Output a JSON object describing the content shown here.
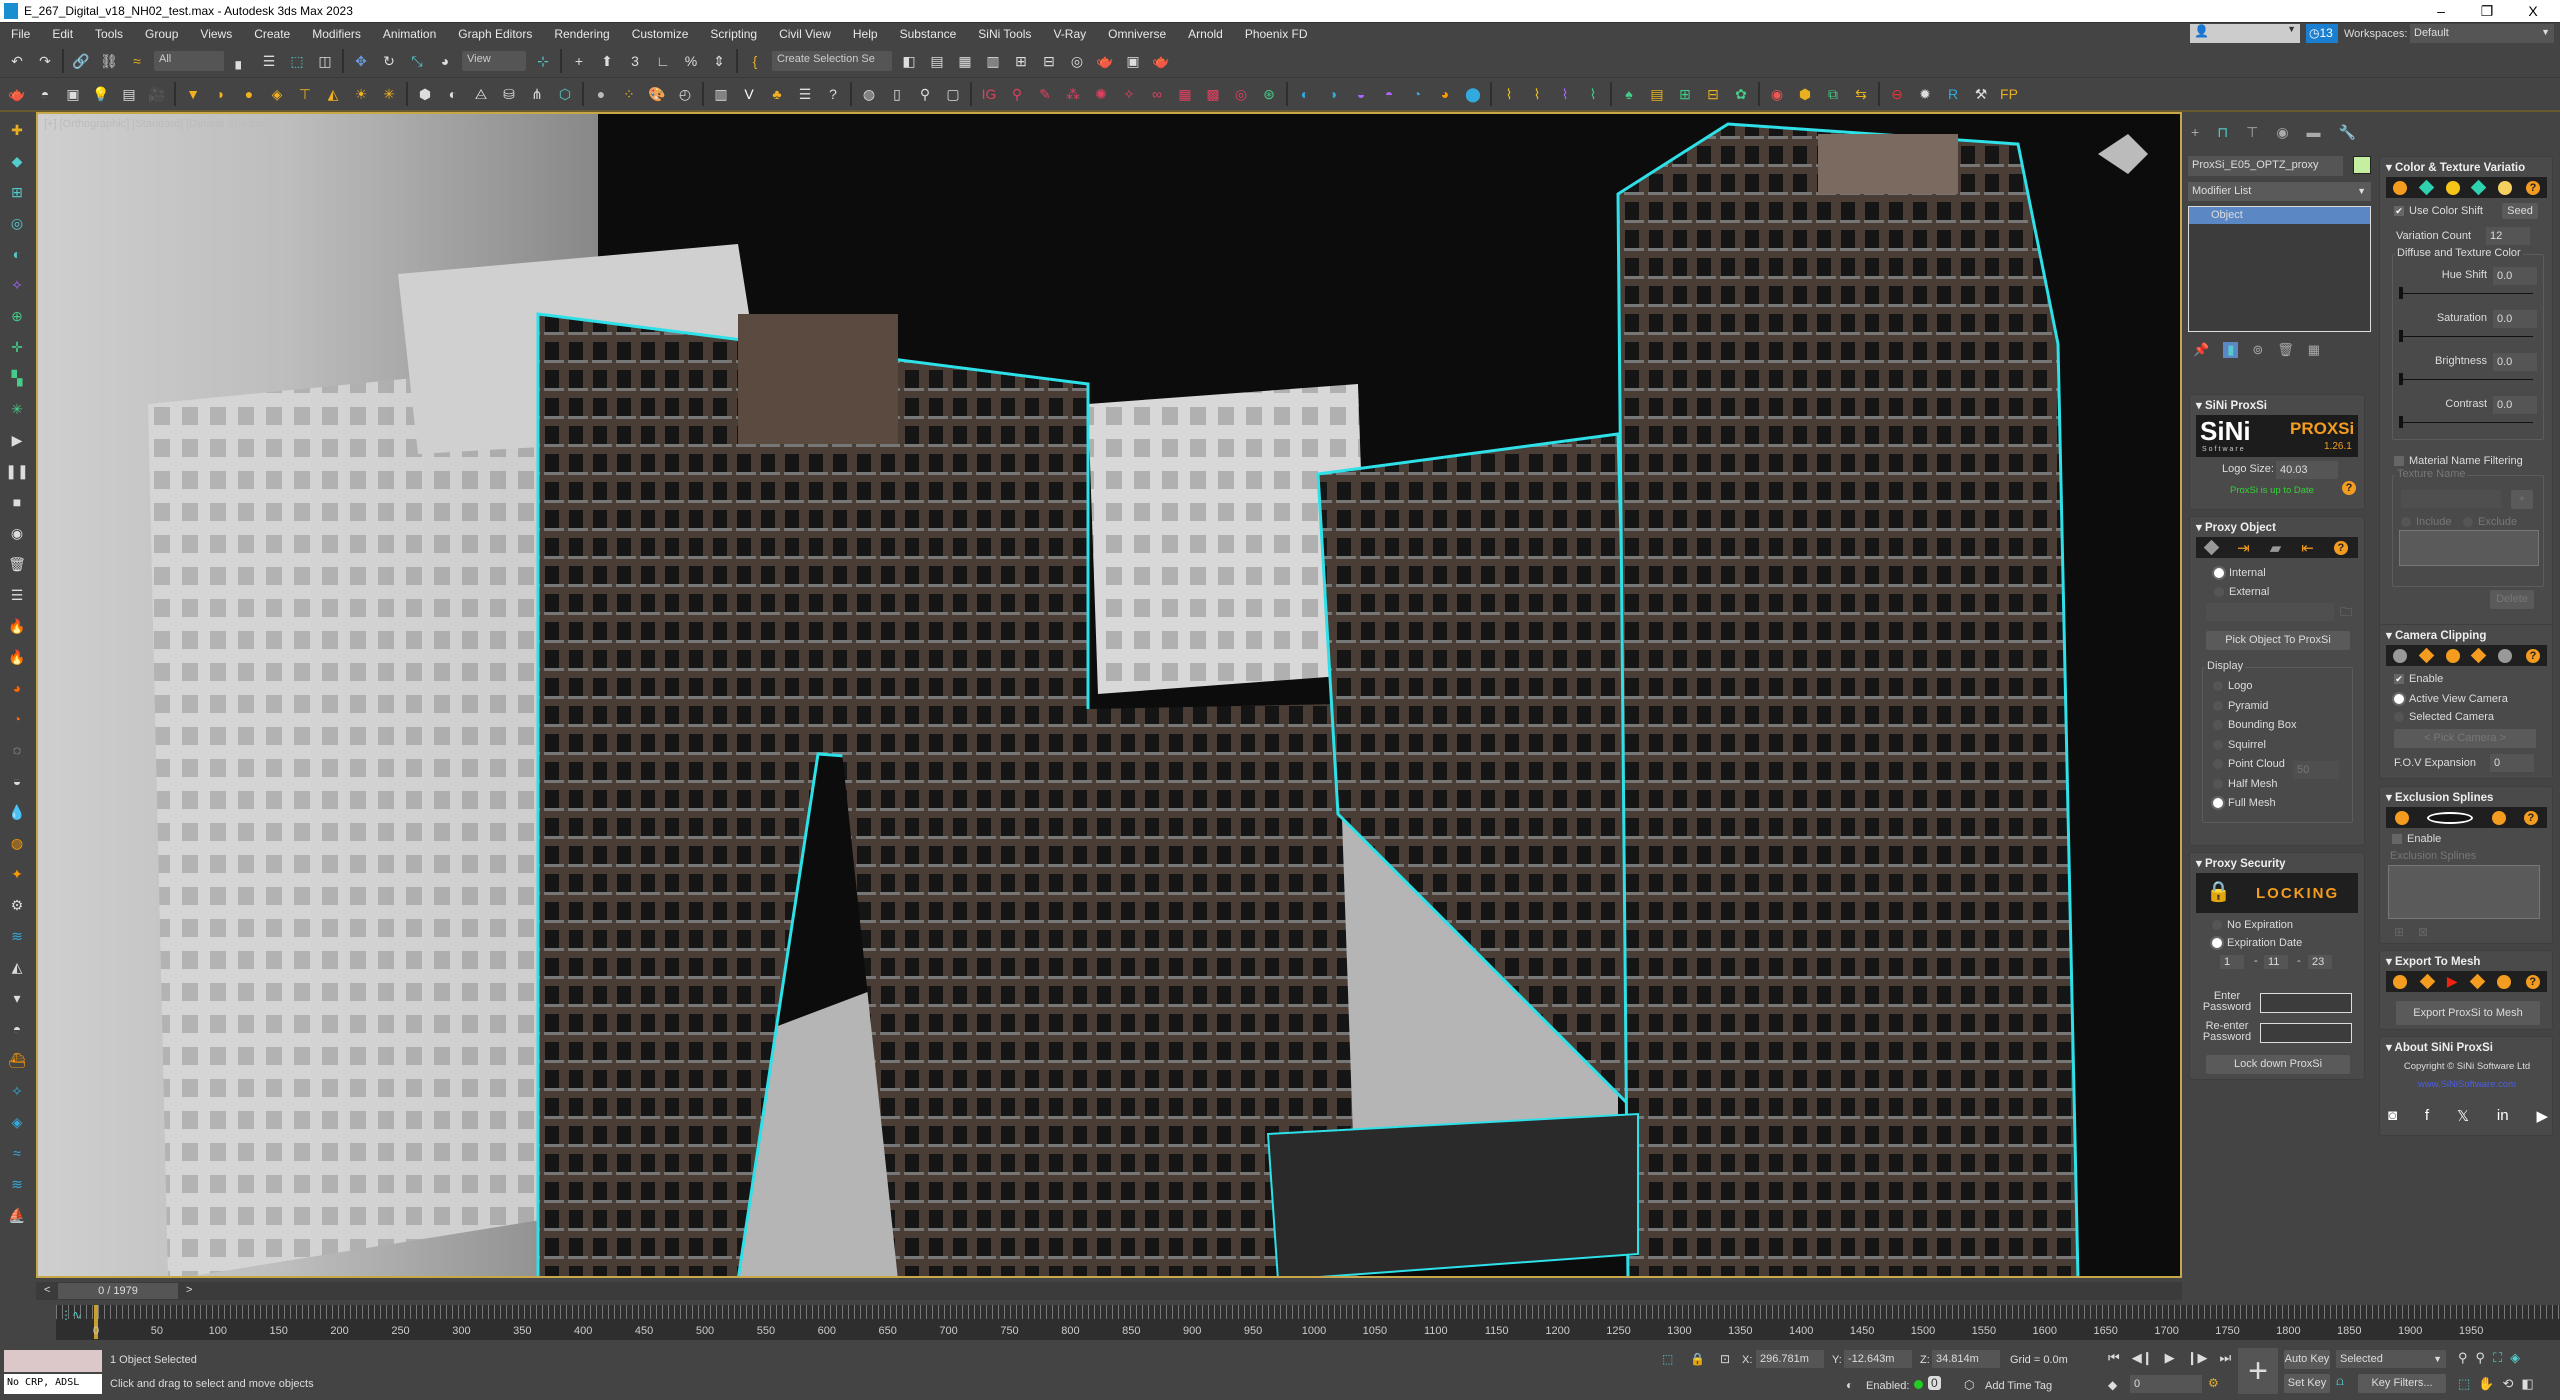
{
  "window": {
    "title": "E_267_Digital_v18_NH02_test.max - Autodesk 3ds Max 2023",
    "minimize": "–",
    "restore": "❐",
    "close": "X"
  },
  "menu": [
    "File",
    "Edit",
    "Tools",
    "Group",
    "Views",
    "Create",
    "Modifiers",
    "Animation",
    "Graph Editors",
    "Rendering",
    "Customize",
    "Scripting",
    "Civil View",
    "Help",
    "Substance",
    "SiNi Tools",
    "V-Ray",
    "Omniverse",
    "Arnold",
    "Phoenix FD"
  ],
  "account": {
    "user_dropdown": "",
    "notifications": "13",
    "workspaces_label": "Workspaces:",
    "workspace": "Default"
  },
  "toolbar1": {
    "selection_filter": "All",
    "ref_coord": "View",
    "named_selection": "Create Selection Se",
    "icons": [
      [
        "undo-icon",
        "#ddd",
        "↶"
      ],
      [
        "redo-icon",
        "#ddd",
        "↷"
      ],
      [
        "sep"
      ],
      [
        "link-icon",
        "#ddd",
        "🔗"
      ],
      [
        "unlink-icon",
        "#ddd",
        "⛓"
      ],
      [
        "bind-space-warp-icon",
        "#e8b020",
        "≈"
      ],
      [
        "DD1"
      ],
      [
        "select-object-icon",
        "#ddd",
        "▖"
      ],
      [
        "select-by-name-icon",
        "#ddd",
        "☰"
      ],
      [
        "rect-selection-icon",
        "#5cc",
        "⬚"
      ],
      [
        "window-crossing-icon",
        "#ddd",
        "◫"
      ],
      [
        "sep"
      ],
      [
        "select-move-icon",
        "#6a9ad8",
        "✥"
      ],
      [
        "select-rotate-icon",
        "#ddd",
        "↻"
      ],
      [
        "select-scale-icon",
        "#5cc",
        "⤡"
      ],
      [
        "place-icon",
        "#ddd",
        "◕"
      ],
      [
        "DD2"
      ],
      [
        "pivot-icon",
        "#5cc",
        "⊹"
      ],
      [
        "sep"
      ],
      [
        "keyboard-shortcut-icon",
        "#ddd",
        "+"
      ],
      [
        "snaps-toggle-icon",
        "#ddd",
        "⬆"
      ],
      [
        "angle-snap-icon",
        "#ddd",
        "3"
      ],
      [
        "percent-snap-icon",
        "#ddd",
        "∟"
      ],
      [
        "spinner-snap-icon",
        "#ddd",
        "%"
      ],
      [
        "edit-named-sel-icon",
        "#ddd",
        "⇕"
      ],
      [
        "sep"
      ],
      [
        "braces-icon",
        "#e8b020",
        "{"
      ],
      [
        "DD3"
      ],
      [
        "mirror-icon",
        "#ddd",
        "◧"
      ],
      [
        "align-icon",
        "#ddd",
        "▤"
      ],
      [
        "layer-explorer-icon",
        "#ddd",
        "▦"
      ],
      [
        "toggle-ribbon-icon",
        "#ddd",
        "▥"
      ],
      [
        "curve-editor-icon",
        "#ddd",
        "⊞"
      ],
      [
        "schematic-icon",
        "#ddd",
        "⊟"
      ],
      [
        "material-editor-icon",
        "#ddd",
        "◎"
      ],
      [
        "render-setup-icon",
        "#ddd",
        "🫖"
      ],
      [
        "rendered-frame-icon",
        "#ddd",
        "▣"
      ],
      [
        "render-icon",
        "#ddd",
        "🫖"
      ]
    ]
  },
  "toolbar2": {
    "icons": [
      [
        "teapot-icon",
        "#ddd",
        "🫖"
      ],
      [
        "sphere-gizmo-icon",
        "#ddd",
        "◓"
      ],
      [
        "container-icon",
        "#ddd",
        "▣"
      ],
      [
        "light-lister-icon",
        "#e8b020",
        "💡"
      ],
      [
        "camera-list-icon",
        "#ddd",
        "▤"
      ],
      [
        "camera-icon",
        "#ddd",
        "🎥"
      ],
      [
        "sep"
      ],
      [
        "spot-light-icon",
        "#f0b020",
        "▼"
      ],
      [
        "dome-light-icon",
        "#f0b020",
        "◗"
      ],
      [
        "sphere-light-icon",
        "#f0b020",
        "●"
      ],
      [
        "mesh-light-icon",
        "#f0b020",
        "◈"
      ],
      [
        "ies-light-icon",
        "#f0b020",
        "⊤"
      ],
      [
        "ambient-light-icon",
        "#f0b020",
        "◭"
      ],
      [
        "sun-icon",
        "#f0b020",
        "☀"
      ],
      [
        "sky-icon",
        "#f0b020",
        "✳"
      ],
      [
        "sep"
      ],
      [
        "proxy-icon",
        "#ddd",
        "⬢"
      ],
      [
        "fur-icon",
        "#ddd",
        "◐"
      ],
      [
        "plane-icon",
        "#ddd",
        "⨺"
      ],
      [
        "instancer-icon",
        "#ddd",
        "⛁"
      ],
      [
        "grass-icon",
        "#ddd",
        "⋔"
      ],
      [
        "volume-icon",
        "#5cc",
        "⬡"
      ],
      [
        "sep"
      ],
      [
        "material-ball-icon",
        "#bbb",
        "●"
      ],
      [
        "multi-material-icon",
        "#f0b020",
        "⁘"
      ],
      [
        "palette-icon",
        "#ddd",
        "🎨"
      ],
      [
        "tex-icon",
        "#ddd",
        "◴"
      ],
      [
        "sep"
      ],
      [
        "lister-icon",
        "#ddd",
        "▥"
      ],
      [
        "vray-logo-icon",
        "#fff",
        "V"
      ],
      [
        "tree-icon",
        "#f0b020",
        "♣"
      ],
      [
        "notes-icon",
        "#ddd",
        "☰"
      ],
      [
        "help-icon",
        "#ddd",
        "?"
      ],
      [
        "sep"
      ],
      [
        "globe-icon",
        "#ddd",
        "◍"
      ],
      [
        "file-icon",
        "#ddd",
        "▯"
      ],
      [
        "pin-icon",
        "#ddd",
        "⚲"
      ],
      [
        "box-icon",
        "#ddd",
        "▢"
      ],
      [
        "sep"
      ],
      [
        "ig-icon",
        "#e04060",
        "IG"
      ],
      [
        "magnify-icon",
        "#e04060",
        "⚲"
      ],
      [
        "brush-icon",
        "#e04060",
        "✎"
      ],
      [
        "scatter-icon",
        "#e04060",
        "⁂"
      ],
      [
        "gear-red-icon",
        "#e04060",
        "✺"
      ],
      [
        "spray-icon",
        "#e04060",
        "✧"
      ],
      [
        "chain-icon",
        "#e04060",
        "∞"
      ],
      [
        "tile-icon",
        "#e04060",
        "▦"
      ],
      [
        "tile2-icon",
        "#e04060",
        "▩"
      ],
      [
        "target-icon",
        "#e04060",
        "◎"
      ],
      [
        "fingerprint-icon",
        "#4c8",
        "⊛"
      ],
      [
        "sep"
      ],
      [
        "sini-1-icon",
        "#3ad",
        "◐"
      ],
      [
        "sini-2-icon",
        "#3ad",
        "◑"
      ],
      [
        "sini-3-icon",
        "#a6f",
        "◒"
      ],
      [
        "sini-4-icon",
        "#a6f",
        "◓"
      ],
      [
        "sini-5-icon",
        "#3ad",
        "◔"
      ],
      [
        "sini-6-icon",
        "#f90",
        "◕"
      ],
      [
        "sini-7-icon",
        "#3ad",
        "⬤"
      ],
      [
        "sep"
      ],
      [
        "clip-1-icon",
        "#e8c020",
        "⌇"
      ],
      [
        "clip-2-icon",
        "#e8c020",
        "⌇"
      ],
      [
        "clip-3-icon",
        "#a6f",
        "⌇"
      ],
      [
        "clip-4-icon",
        "#4c8",
        "⌇"
      ],
      [
        "sep"
      ],
      [
        "forest-icon",
        "#4c8",
        "♠"
      ],
      [
        "railclone-icon",
        "#e8b020",
        "▤"
      ],
      [
        "ornatrix-icon",
        "#4c8",
        "⊞"
      ],
      [
        "city-icon",
        "#e8b020",
        "⊟"
      ],
      [
        "paint-icon",
        "#4c8",
        "✿"
      ],
      [
        "sep"
      ],
      [
        "color-wheel-icon",
        "#e55",
        "◉"
      ],
      [
        "cube-multi-icon",
        "#e8b020",
        "⬢"
      ],
      [
        "ortho-icon",
        "#4c8",
        "⧉"
      ],
      [
        "swap-icon",
        "#e8b020",
        "⇆"
      ],
      [
        "sep"
      ],
      [
        "sini-red-icon",
        "#e33",
        "⊖"
      ],
      [
        "gear-icon",
        "#ddd",
        "✹"
      ],
      [
        "r-icon",
        "#3ad",
        "R"
      ],
      [
        "tools-icon",
        "#ddd",
        "⚒"
      ],
      [
        "fp-icon",
        "#e8b020",
        "FP"
      ]
    ]
  },
  "left_toolbar": {
    "icons": [
      [
        "create-icon",
        "#e8b020",
        "✚"
      ],
      [
        "modify-icon",
        "#5cc",
        "◆"
      ],
      [
        "hierarchy-icon",
        "#5cc",
        "⊞"
      ],
      [
        "motion-icon",
        "#5cc",
        "◎"
      ],
      [
        "display-icon",
        "#5cc",
        "◐"
      ],
      [
        "utilities-icon",
        "#a6f",
        "✧"
      ],
      [
        "shapes-icon",
        "#4c8",
        "⊕"
      ],
      [
        "helpers-icon",
        "#4c8",
        "✛"
      ],
      [
        "grid-icon",
        "#4c8",
        "▚"
      ],
      [
        "spacewarp-icon",
        "#4c8",
        "✳"
      ],
      [
        "play-icon",
        "#ddd",
        "▶"
      ],
      [
        "pause-icon",
        "#ddd",
        "❚❚"
      ],
      [
        "stop-icon",
        "#ddd",
        "■"
      ],
      [
        "record-icon",
        "#ddd",
        "◉"
      ],
      [
        "trash-icon",
        "#ddd",
        "🗑"
      ],
      [
        "list-icon",
        "#ddd",
        "☰"
      ],
      [
        "fire-icon",
        "#f90",
        "🔥"
      ],
      [
        "fire2-icon",
        "#f60",
        "🔥"
      ],
      [
        "fire3-icon",
        "#f60",
        "◕"
      ],
      [
        "fire4-icon",
        "#f60",
        "◔"
      ],
      [
        "bot-icon",
        "#ddd",
        "◌"
      ],
      [
        "pot-icon",
        "#ddd",
        "◒"
      ],
      [
        "drop-icon",
        "#f90",
        "💧"
      ],
      [
        "torch-icon",
        "#f90",
        "◍"
      ],
      [
        "star-icon",
        "#f90",
        "✦"
      ],
      [
        "gear2-icon",
        "#ddd",
        "⚙"
      ],
      [
        "wave-icon",
        "#3ad",
        "≋"
      ],
      [
        "rocket-icon",
        "#ddd",
        "◭"
      ],
      [
        "cup-icon",
        "#ddd",
        "▾"
      ],
      [
        "bulb-icon",
        "#ddd",
        "◓"
      ],
      [
        "ship-icon",
        "#f90",
        "⛴"
      ],
      [
        "star2-icon",
        "#3ad",
        "✧"
      ],
      [
        "shield-icon",
        "#3ad",
        "◈"
      ],
      [
        "wave2-icon",
        "#3ad",
        "≈"
      ],
      [
        "pool-icon",
        "#3ad",
        "≋"
      ],
      [
        "boat-icon",
        "#3ad",
        "⛵"
      ]
    ]
  },
  "viewport": {
    "label": "[+] [Orthographic] [Standard] [Default Shading]"
  },
  "command_panel": {
    "object_name": "ProxSi_E05_OPTZ_proxy",
    "object_color": "#c6eea0",
    "modifier_list": "Modifier List",
    "stack": [
      "Object"
    ],
    "sini_proxsi": {
      "title": "SiNi ProxSi",
      "logo_left": "SiNi",
      "logo_sub": "Software",
      "logo_right": "PROXSi",
      "version": "1.26.1",
      "logo_size_label": "Logo Size:",
      "logo_size": "40.03",
      "status": "ProxSi is up to Date"
    },
    "proxy_object": {
      "title": "Proxy Object",
      "internal": "Internal",
      "external": "External",
      "pick_button": "Pick Object To ProxSi",
      "display_label": "Display",
      "display_options": [
        "Logo",
        "Pyramid",
        "Bounding Box",
        "Squirrel",
        "Point Cloud",
        "Half Mesh",
        "Full Mesh"
      ],
      "point_cloud_value": "50",
      "selected": "Full Mesh"
    },
    "proxy_security": {
      "title": "Proxy Security",
      "banner": "LOCKING",
      "no_expiration": "No Expiration",
      "expiration_date": "Expiration Date",
      "date": [
        "1",
        "11",
        "23"
      ],
      "date_sep": "-",
      "enter_password": "Enter Password",
      "reenter_password": "Re-enter Password",
      "lock_button": "Lock down ProxSi"
    },
    "color_texture": {
      "title": "Color & Texture Variatio",
      "use_color_shift": "Use Color Shift",
      "use_color_shift_checked": true,
      "seed": "Seed",
      "variation_count_label": "Variation Count",
      "variation_count": "12",
      "group_label": "Diffuse and Texture Color",
      "sliders": [
        {
          "label": "Hue Shift",
          "value": "0.0"
        },
        {
          "label": "Saturation",
          "value": "0.0"
        },
        {
          "label": "Brightness",
          "value": "0.0"
        },
        {
          "label": "Contrast",
          "value": "0.0"
        }
      ],
      "material_filter": "Material Name Filtering",
      "texture_name": "Texture Name",
      "add": "+",
      "include": "Include",
      "exclude": "Exclude",
      "delete": "Delete"
    },
    "camera_clipping": {
      "title": "Camera Clipping",
      "enable": "Enable",
      "enabled": true,
      "active_view": "Active View Camera",
      "selected_camera": "Selected Camera",
      "pick_camera": "< Pick Camera >",
      "fov_label": "F.O.V Expansion",
      "fov": "0"
    },
    "exclusion_splines": {
      "title": "Exclusion Splines",
      "enable": "Enable",
      "list_label": "Exclusion Splines"
    },
    "export_mesh": {
      "title": "Export To Mesh",
      "button": "Export ProxSi to Mesh"
    },
    "about": {
      "title": "About SiNi ProxSi",
      "copyright": "Copyright © SiNi Software Ltd",
      "link": "www.SiNiSoftware.com"
    },
    "accent": "#f39c1f",
    "teal": "#2ed1b0"
  },
  "timeline": {
    "frame": "0 / 1979",
    "prev": "<",
    "next": ">",
    "ticks": [
      "0",
      "50",
      "100",
      "150",
      "200",
      "250",
      "300",
      "350",
      "400",
      "450",
      "500",
      "550",
      "600",
      "650",
      "700",
      "750",
      "800",
      "850",
      "900",
      "950",
      "1000",
      "1050",
      "1100",
      "1150",
      "1200",
      "1250",
      "1300",
      "1350",
      "1400",
      "1450",
      "1500",
      "1550",
      "1600",
      "1650",
      "1700",
      "1750",
      "1800",
      "1850",
      "1900",
      "1950"
    ]
  },
  "status": {
    "maxscript_output": "No CRP, ADSL",
    "selection": "1 Object Selected",
    "prompt": "Click and drag to select and move objects",
    "x_label": "X:",
    "x": "296.781m",
    "y_label": "Y:",
    "y": "-12.643m",
    "z_label": "Z:",
    "z": "34.814m",
    "grid": "Grid = 0.0m",
    "enabled_label": "Enabled:",
    "add_time_tag": "Add Time Tag",
    "auto_key": "Auto Key",
    "set_key": "Set Key",
    "key_mode": "Selected",
    "key_filters": "Key Filters...",
    "current_frame": "0"
  }
}
